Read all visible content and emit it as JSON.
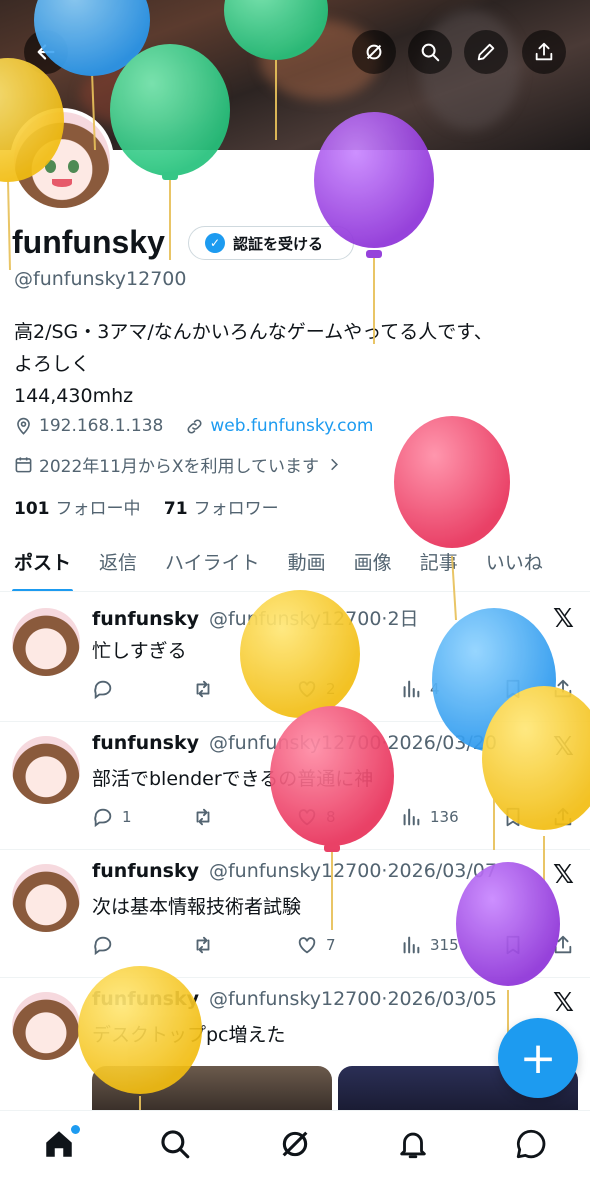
{
  "profile": {
    "display_name": "funfunsky",
    "verify_label": "認証を受ける",
    "handle": "@funfunsky12700",
    "bio_line1": "高2/SG・3アマ/なんかいろんなゲームやってる人です、",
    "bio_line2": "よろしく",
    "bio_line3": "144,430mhz",
    "location": "192.168.1.138",
    "website": "web.funfunsky.com",
    "joined": "2022年11月からXを利用しています",
    "following_count": "101",
    "following_label": "フォロー中",
    "followers_count": "71",
    "followers_label": "フォロワー"
  },
  "tabs": [
    "ポスト",
    "返信",
    "ハイライト",
    "動画",
    "画像",
    "記事",
    "いいね"
  ],
  "tweets": [
    {
      "name": "funfunsky",
      "meta": "@funfunsky12700·2日",
      "text": "忙しすぎる",
      "replies": "",
      "retweets": "",
      "likes": "2",
      "views": "4"
    },
    {
      "name": "funfunsky",
      "meta": "@funfunsky12700·2026/03/20",
      "text": "部活でblenderできるの普通に神",
      "replies": "1",
      "retweets": "",
      "likes": "8",
      "views": "136"
    },
    {
      "name": "funfunsky",
      "meta": "@funfunsky12700·2026/03/07",
      "text": "次は基本情報技術者試験",
      "replies": "",
      "retweets": "",
      "likes": "7",
      "views": "315"
    },
    {
      "name": "funfunsky",
      "meta": "@funfunsky12700·2026/03/05",
      "text": "デスクトップpc増えた"
    }
  ],
  "fab_label": "+",
  "x_logo": "𝕏",
  "colors": {
    "accent": "#1d9bf0",
    "text": "#0f1419",
    "muted": "#536471"
  },
  "icons": [
    "back-icon",
    "grok-icon",
    "search-icon",
    "edit-icon",
    "share-icon",
    "home-icon",
    "bell-icon",
    "messages-icon"
  ]
}
